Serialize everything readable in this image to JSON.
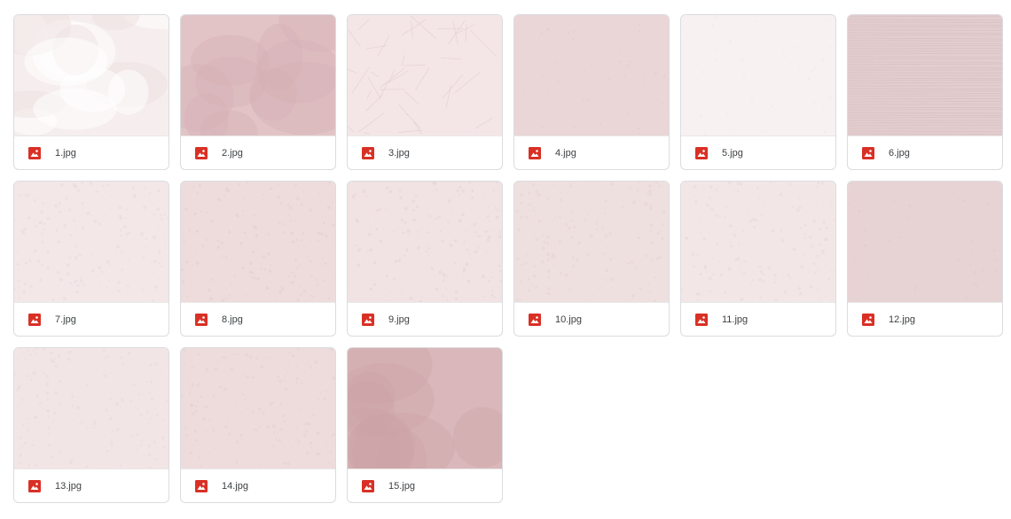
{
  "icon": "image-file-icon",
  "icon_color": "#d93025",
  "files": [
    {
      "name": "1.jpg",
      "base": "#f6eeee",
      "tone": "#ffffff",
      "texture": "clouds"
    },
    {
      "name": "2.jpg",
      "base": "#e2c4c7",
      "tone": "#d4b0b4",
      "texture": "stain"
    },
    {
      "name": "3.jpg",
      "base": "#f4e6e7",
      "tone": "#e3cfd1",
      "texture": "crumple"
    },
    {
      "name": "4.jpg",
      "base": "#ead6d7",
      "tone": "#e2ccce",
      "texture": "flat"
    },
    {
      "name": "5.jpg",
      "base": "#f8f1f1",
      "tone": "#f1e6e7",
      "texture": "flat"
    },
    {
      "name": "6.jpg",
      "base": "#e3cdce",
      "tone": "#d6bdbf",
      "texture": "lines"
    },
    {
      "name": "7.jpg",
      "base": "#f3e7e8",
      "tone": "#ebdcdd",
      "texture": "grain"
    },
    {
      "name": "8.jpg",
      "base": "#eedcdc",
      "tone": "#e4cfd0",
      "texture": "grain"
    },
    {
      "name": "9.jpg",
      "base": "#f1e3e3",
      "tone": "#e6d4d5",
      "texture": "grain"
    },
    {
      "name": "10.jpg",
      "base": "#efe0e0",
      "tone": "#e5d3d3",
      "texture": "grain"
    },
    {
      "name": "11.jpg",
      "base": "#f2e6e7",
      "tone": "#e9dadb",
      "texture": "grain"
    },
    {
      "name": "12.jpg",
      "base": "#e8d3d4",
      "tone": "#dfc8c9",
      "texture": "flat"
    },
    {
      "name": "13.jpg",
      "base": "#f2e5e6",
      "tone": "#eadbdc",
      "texture": "grain"
    },
    {
      "name": "14.jpg",
      "base": "#eedcdd",
      "tone": "#e4d0d1",
      "texture": "grain"
    },
    {
      "name": "15.jpg",
      "base": "#d9b7ba",
      "tone": "#caa3a7",
      "texture": "stain"
    }
  ]
}
